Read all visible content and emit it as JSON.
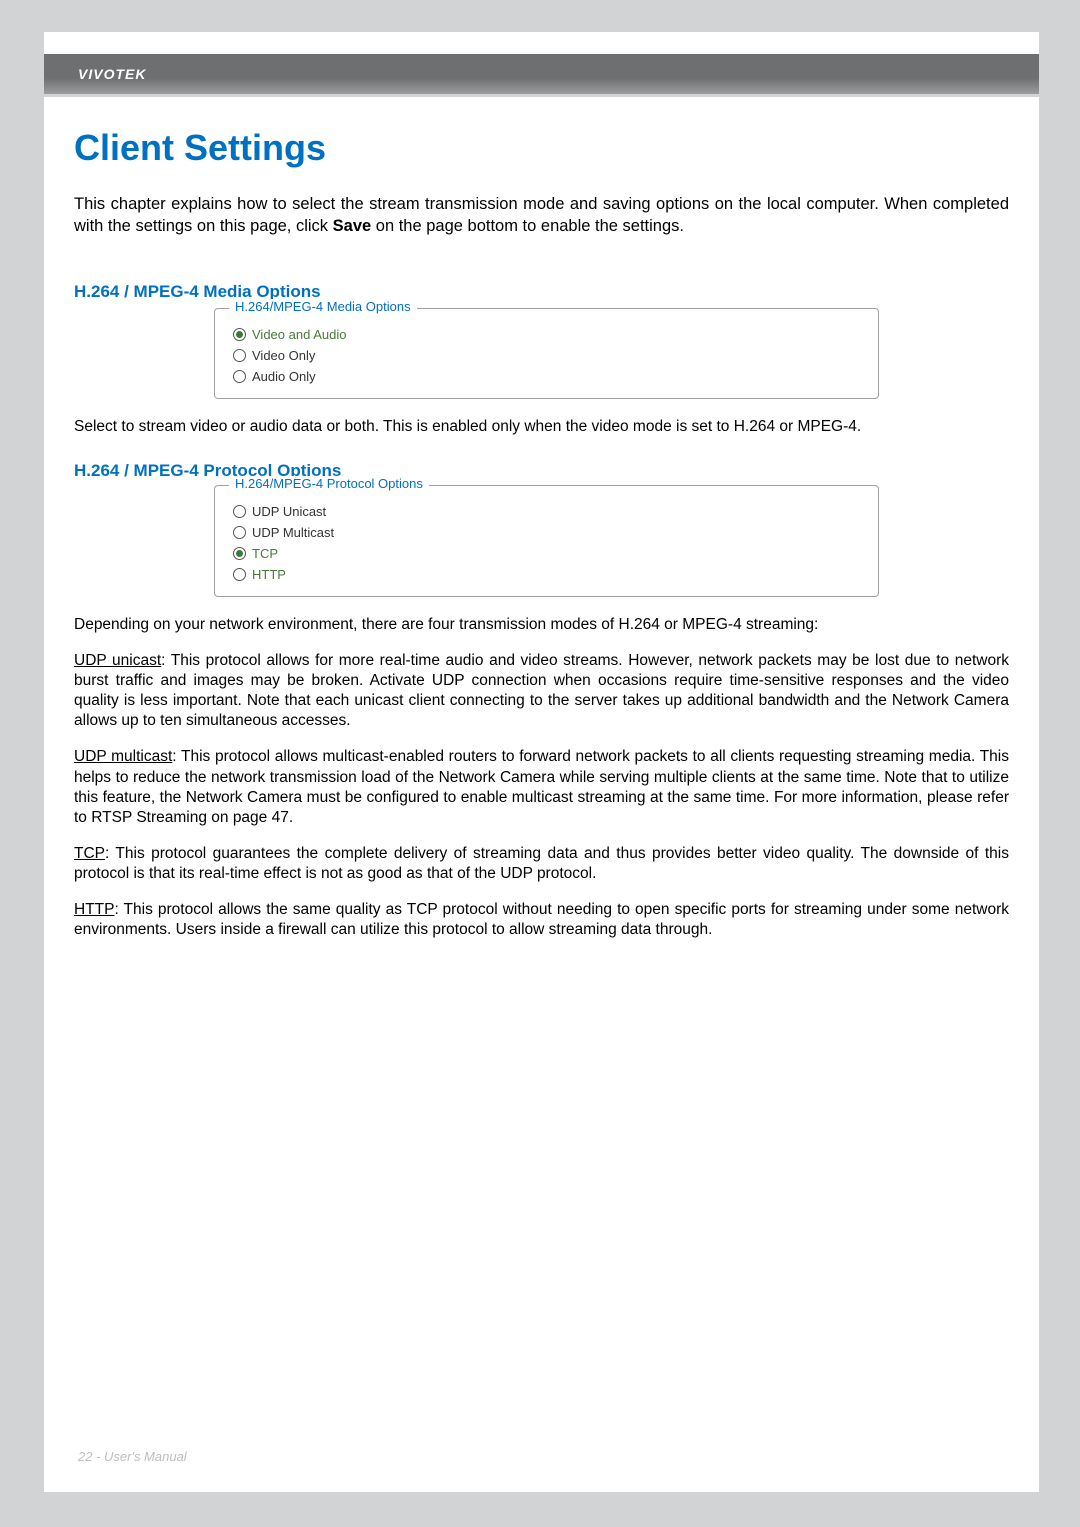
{
  "header": {
    "brand": "VIVOTEK"
  },
  "title": "Client Settings",
  "intro": {
    "before_bold": "This chapter explains how to select the stream transmission mode and saving options on the local computer. When completed with the settings on this page, click ",
    "bold": "Save",
    "after_bold": " on the page bottom to enable the settings."
  },
  "media": {
    "section_title": "H.264 / MPEG-4 Media Options",
    "legend": "H.264/MPEG-4 Media Options",
    "options": {
      "video_audio": "Video and Audio",
      "video_only": "Video Only",
      "audio_only": "Audio Only"
    },
    "note": "Select to stream video or audio data or both. This is enabled only when the video mode is set to H.264 or MPEG-4."
  },
  "protocol": {
    "section_title": "H.264 / MPEG-4 Protocol Options",
    "legend": "H.264/MPEG-4 Protocol Options",
    "options": {
      "udp_unicast": "UDP Unicast",
      "udp_multicast": "UDP Multicast",
      "tcp": "TCP",
      "http": "HTTP"
    },
    "intro": "Depending on your network environment, there are four transmission modes of H.264 or MPEG-4 streaming:",
    "udp_unicast": {
      "name": "UDP unicast",
      "text": ": This protocol allows for more real-time audio and video streams. However, network packets may be lost due to network burst traffic and images may be broken. Activate UDP connection when occasions require time-sensitive responses and the video quality is less important. Note that each unicast client connecting to the server takes up additional bandwidth and the Network Camera allows up to ten simultaneous accesses."
    },
    "udp_multicast": {
      "name": "UDP multicast",
      "text": ": This protocol allows multicast-enabled routers to forward network packets to all clients requesting streaming media. This helps to reduce the network transmission load of the Network Camera while serving multiple clients at the same time. Note that to utilize this feature, the Network Camera must be configured to enable multicast streaming at the same time. For more information, please refer to RTSP Streaming on page 47."
    },
    "tcp": {
      "name": "TCP",
      "text": ": This protocol guarantees the complete delivery of streaming data and thus provides better video quality. The downside of this protocol is that its real-time effect is not as good as that of the UDP protocol."
    },
    "http": {
      "name": "HTTP",
      "text": ": This protocol allows the same quality as TCP protocol without needing to open specific ports for streaming under some network environments. Users inside a firewall can utilize this protocol to allow streaming data through."
    }
  },
  "footer": "22 - User's Manual"
}
